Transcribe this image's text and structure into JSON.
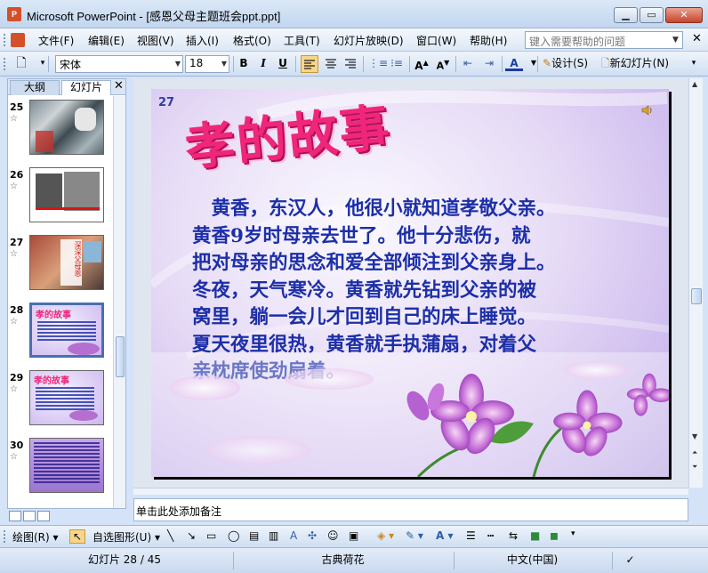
{
  "window": {
    "title": "Microsoft PowerPoint - [感恩父母主题班会ppt.ppt]",
    "app_icon_letter": "P"
  },
  "menubar": {
    "items": [
      "文件(F)",
      "编辑(E)",
      "视图(V)",
      "插入(I)",
      "格式(O)",
      "工具(T)",
      "幻灯片放映(D)",
      "窗口(W)",
      "帮助(H)"
    ],
    "help_placeholder": "键入需要帮助的问题"
  },
  "toolbar": {
    "font": "宋体",
    "font_size": "18",
    "bold": "B",
    "italic": "I",
    "underline": "U",
    "design_label": "设计(S)",
    "new_slide_label": "新幻灯片(N)"
  },
  "leftpane": {
    "tab_outline": "大纲",
    "tab_slides": "幻灯片",
    "slides": [
      {
        "num": "25"
      },
      {
        "num": "26"
      },
      {
        "num": "27"
      },
      {
        "num": "28",
        "selected": true
      },
      {
        "num": "29"
      },
      {
        "num": "30"
      }
    ],
    "thumb27_text": "深深父母恩"
  },
  "slide": {
    "number": "27",
    "title": "孝的故事",
    "body_lines": [
      "　黄香，东汉人，他很小就知道孝敬父亲。",
      "黄香9岁时母亲去世了。他十分悲伤，就",
      "把对母亲的思念和爱全部倾注到父亲身上。",
      "冬夜，天气寒冷。黄香就先钻到父亲的被",
      "窝里，躺一会儿才回到自己的床上睡觉。",
      "夏天夜里很热，黄香就手执蒲扇，对着父",
      "亲枕席使劲扇着。"
    ]
  },
  "notes": {
    "placeholder": "单击此处添加备注"
  },
  "drawbar": {
    "draw_label": "绘图(R)",
    "autoshape_label": "自选图形(U)"
  },
  "statusbar": {
    "slide_info": "幻灯片 28 / 45",
    "design": "古典荷花",
    "language": "中文(中国)"
  },
  "colors": {
    "title_pink": "#f0267b",
    "body_blue": "#1c2fa8",
    "selected_button": "#f7d58a"
  }
}
